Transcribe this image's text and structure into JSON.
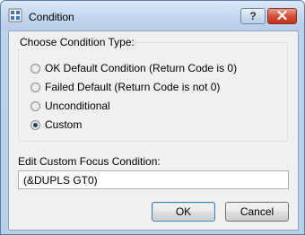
{
  "window": {
    "title": "Condition",
    "help_label": "?"
  },
  "group": {
    "legend": "Choose Condition Type:",
    "options": [
      {
        "label": "OK Default Condition (Return Code is 0)",
        "checked": false
      },
      {
        "label": "Failed Default (Return Code is not 0)",
        "checked": false
      },
      {
        "label": "Unconditional",
        "checked": false
      },
      {
        "label": "Custom",
        "checked": true
      }
    ]
  },
  "edit": {
    "label": "Edit Custom Focus Condition:",
    "value": "(&DUPLS GT0)"
  },
  "buttons": {
    "ok_label": "OK",
    "cancel_label": "Cancel"
  },
  "icons": {
    "app": "condition-app-icon",
    "help": "help-icon",
    "close": "close-icon"
  }
}
